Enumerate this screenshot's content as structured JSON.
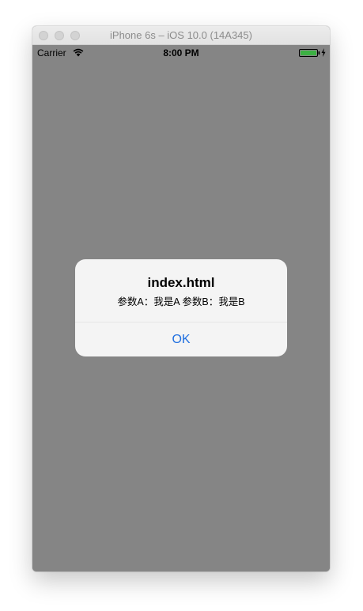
{
  "window": {
    "title": "iPhone 6s – iOS 10.0 (14A345)"
  },
  "status_bar": {
    "carrier": "Carrier",
    "time": "8:00 PM",
    "icons": [
      "wifi-icon",
      "battery-icon",
      "charging-icon"
    ],
    "battery_color": "#3cb043"
  },
  "alert": {
    "title": "index.html",
    "message": "参数A：我是A    参数B：我是B",
    "button_label": "OK",
    "button_color": "#1f6fe0"
  },
  "colors": {
    "overlay": "#858585",
    "alert_background": "#f6f6f6"
  }
}
